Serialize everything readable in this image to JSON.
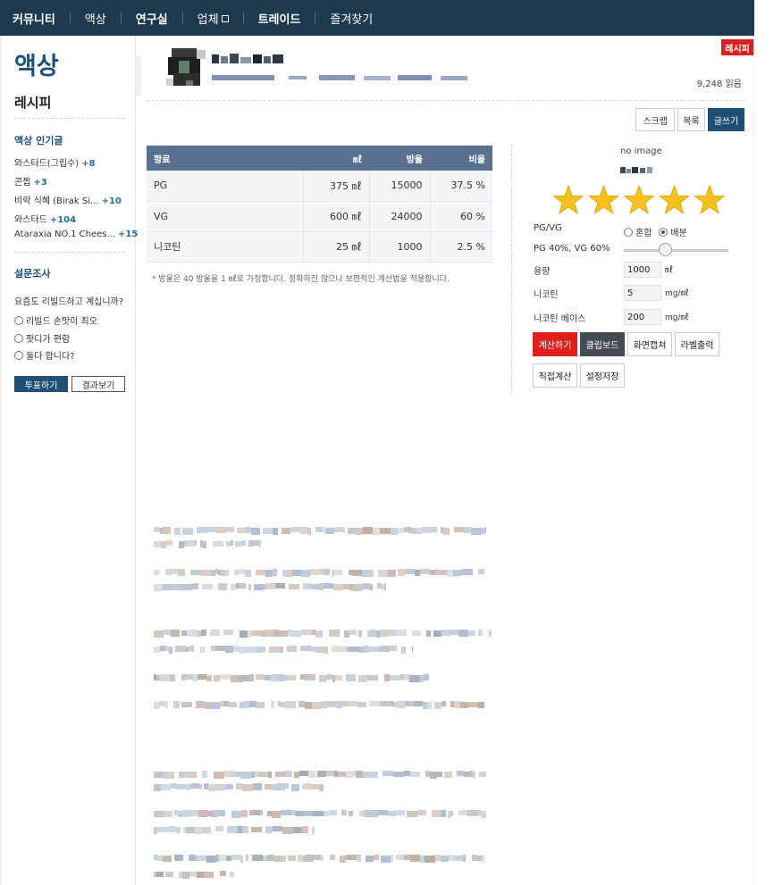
{
  "nav": {
    "community": "커뮤니티",
    "liquid": "액상",
    "lab": "연구실",
    "vendor": "업체",
    "trade": "트레이드",
    "favorites": "즐겨찾기"
  },
  "sidebar": {
    "title": "액상",
    "subtitle": "레시피",
    "popular_heading": "액상 인기글",
    "popular": [
      {
        "title": "와스타드(그립수)",
        "count": "+8"
      },
      {
        "title": "콘찝",
        "count": "+3"
      },
      {
        "title": "비락 식혜 (Birak Si...",
        "count": "+10"
      },
      {
        "title": "와스타드",
        "count": "+104"
      },
      {
        "title": "Ataraxia NO.1 Chees...",
        "count": "+15"
      }
    ],
    "poll_heading": "설문조사",
    "poll_question": "요즘도 리빌드하고 계십니까?",
    "poll_options": [
      "리빌드 손맛이 최오",
      "팟디가 편함",
      "둘다 합니다?"
    ],
    "vote_button": "투표하기",
    "results_button": "결과보기"
  },
  "post": {
    "tag": "레시피",
    "views": "9,248 읽음",
    "actions": {
      "scrap": "스크랩",
      "list": "목록",
      "write": "글쓰기"
    }
  },
  "ratio_table": {
    "headers": [
      "항료",
      "㎖",
      "방울",
      "비율"
    ],
    "rows": [
      [
        "PG",
        "375 ㎖",
        "15000",
        "37.5 %"
      ],
      [
        "VG",
        "600 ㎖",
        "24000",
        "60 %"
      ],
      [
        "니코틴",
        "25 ㎖",
        "1000",
        "2.5 %"
      ]
    ],
    "note": "* 방울은 40 방울을 1 ㎖로 가정합니다. 정확하진 않으나 보편적인 계산법을 적용합니다."
  },
  "calculator": {
    "no_image": "no image",
    "rating_stars": 5,
    "pgvg_label": "PG/VG",
    "mix_option": "혼합",
    "split_option": "배분",
    "ratio_label": "PG 40%, VG 60%",
    "slider_value": 0.4,
    "volume_label": "용량",
    "volume_value": "1000",
    "volume_unit": "㎖",
    "nicotine_label": "니코틴",
    "nicotine_value": "5",
    "nicotine_unit": "mg/㎖",
    "base_label": "니코틴 베이스",
    "base_value": "200",
    "base_unit": "mg/㎖",
    "buttons": {
      "calculate": "계산하기",
      "clipboard": "클립보드",
      "capture": "화면캡쳐",
      "label_print": "라벨출력",
      "direct": "직접계산",
      "save": "설정저장"
    }
  },
  "colors": {
    "nav_bg": "#1d3a4f",
    "accent": "#1f5175",
    "table_header": "#5a7190",
    "red": "#e0201a",
    "star": "#f7c21e"
  }
}
